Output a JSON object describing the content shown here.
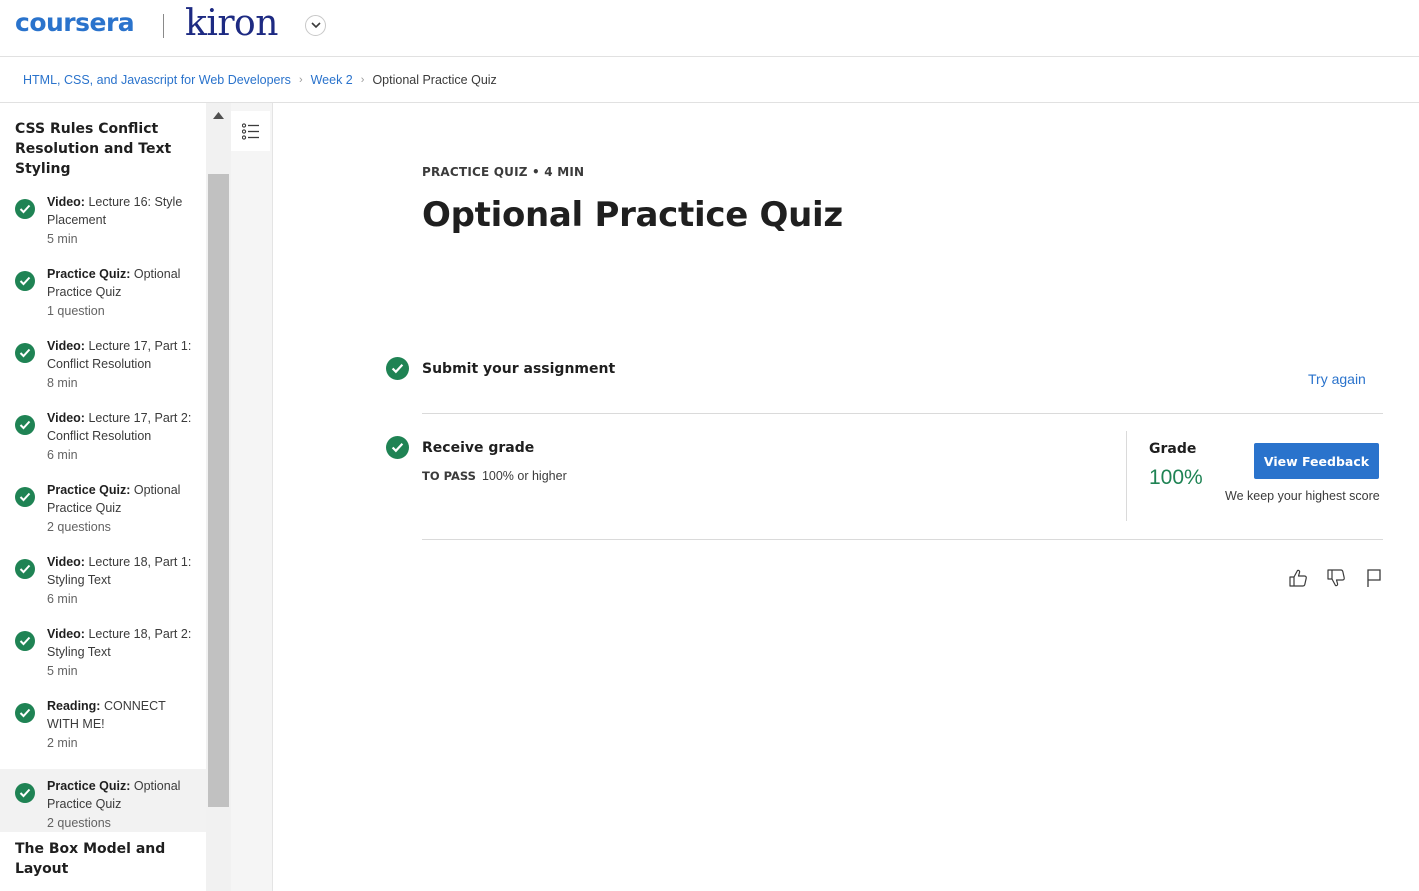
{
  "header": {
    "logo_coursera": "coursera",
    "logo_partner": "kiron"
  },
  "breadcrumb": {
    "course": "HTML, CSS, and Javascript for Web Developers",
    "week": "Week 2",
    "current": "Optional Practice Quiz"
  },
  "sidebar": {
    "section_title": "CSS Rules Conflict Resolution and Text Styling",
    "items": [
      {
        "kind": "Video:",
        "title": "Lecture 16: Style Placement",
        "meta": "5 min"
      },
      {
        "kind": "Practice Quiz:",
        "title": "Optional Practice Quiz",
        "meta": "1 question"
      },
      {
        "kind": "Video:",
        "title": "Lecture 17, Part 1: Conflict Resolution",
        "meta": "8 min"
      },
      {
        "kind": "Video:",
        "title": "Lecture 17, Part 2: Conflict Resolution",
        "meta": "6 min"
      },
      {
        "kind": "Practice Quiz:",
        "title": "Optional Practice Quiz",
        "meta": "2 questions"
      },
      {
        "kind": "Video:",
        "title": "Lecture 18, Part 1: Styling Text",
        "meta": "6 min"
      },
      {
        "kind": "Video:",
        "title": "Lecture 18, Part 2: Styling Text",
        "meta": "5 min"
      },
      {
        "kind": "Reading:",
        "title": "CONNECT WITH ME!",
        "meta": "2 min"
      },
      {
        "kind": "Practice Quiz:",
        "title": "Optional Practice Quiz",
        "meta": "2 questions"
      }
    ],
    "next_section_title": "The Box Model and Layout"
  },
  "main": {
    "eyebrow": "PRACTICE QUIZ • 4 MIN",
    "title": "Optional Practice Quiz",
    "submit_step": {
      "title": "Submit your assignment",
      "action": "Try again"
    },
    "grade_step": {
      "title": "Receive grade",
      "to_pass_label": "TO PASS",
      "to_pass_value": "100% or higher",
      "grade_label": "Grade",
      "grade_value": "100%",
      "button": "View Feedback",
      "note": "We keep your highest score"
    }
  },
  "colors": {
    "accent": "#2a73cc",
    "success": "#1f8354",
    "partner_brand": "#1d2a82"
  }
}
